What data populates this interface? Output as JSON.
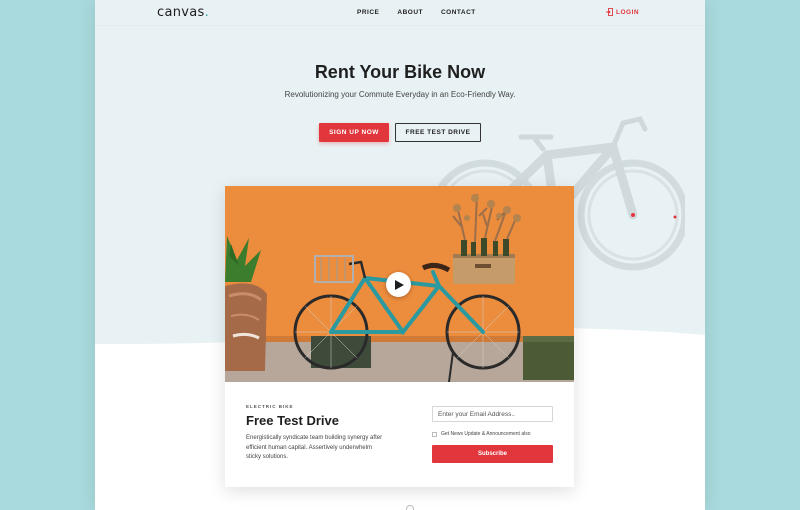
{
  "header": {
    "logo_text": "canvas",
    "logo_dot": ".",
    "nav": [
      {
        "label": "PRICE"
      },
      {
        "label": "ABOUT"
      },
      {
        "label": "CONTACT"
      }
    ],
    "login_label": "LOGIN",
    "login_icon": "login-icon"
  },
  "hero": {
    "title": "Rent Your Bike Now",
    "subtitle": "Revolutionizing your Commute Everyday in an Eco-Friendly Way.",
    "primary_button": "SIGN UP NOW",
    "secondary_button": "FREE TEST DRIVE",
    "background_image": "bike-silhouette"
  },
  "card": {
    "video": {
      "image": "bicycle-against-orange-wall",
      "play_icon": "play-icon"
    },
    "eyebrow": "ELECTRIC BIKE",
    "title": "Free Test Drive",
    "description": "Energistically syndicate team building synergy after efficient human capital. Assertively underwhelm sticky solutions.",
    "email_placeholder": "Enter your Email Address..",
    "checkbox_label": "Get News Update & Announcement also",
    "subscribe_button": "Subscribe"
  },
  "colors": {
    "outer_background": "#a9dadd",
    "hero_background": "#e8f2f4",
    "accent_red": "#e2363d",
    "logo_dot": "#2ea99f",
    "text_dark": "#1f1f1f"
  }
}
